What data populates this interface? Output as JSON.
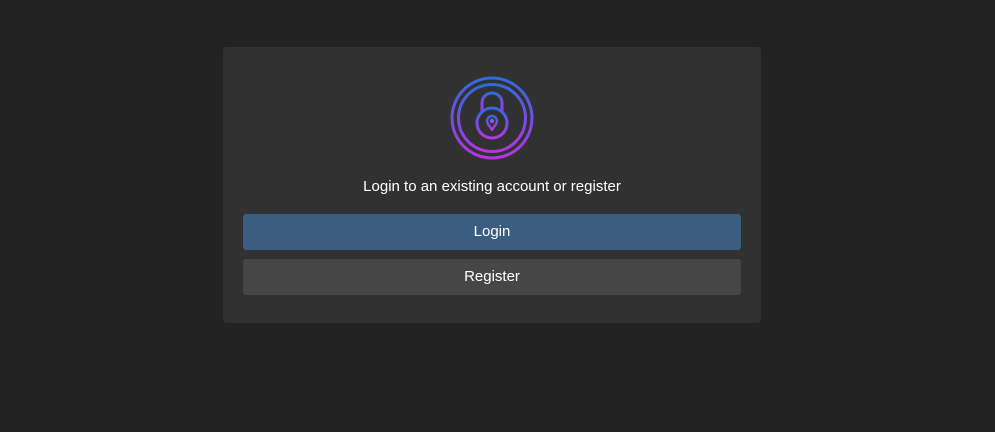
{
  "login_card": {
    "icon": "lock-icon",
    "prompt": "Login to an existing account or register",
    "login_label": "Login",
    "register_label": "Register"
  },
  "colors": {
    "page_background": "#222222",
    "card_background": "#313131",
    "login_button": "#3a5d80",
    "register_button": "#464646",
    "icon_gradient_top": "#2f6bdc",
    "icon_gradient_bottom": "#b633e6"
  }
}
